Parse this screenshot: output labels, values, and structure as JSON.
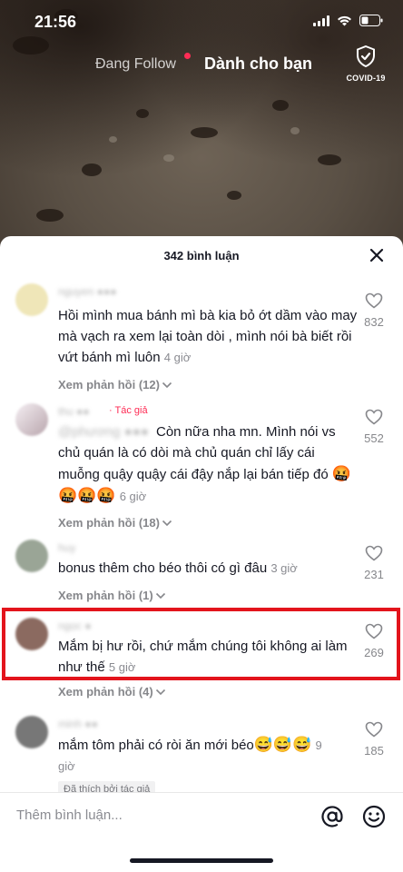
{
  "status_bar": {
    "time": "21:56"
  },
  "top_tabs": {
    "following": "Đang Follow",
    "for_you": "Dành cho bạn",
    "covid_label": "COVID-19"
  },
  "comments_sheet": {
    "title": "342 bình luận",
    "comments": [
      {
        "text": "Hồi mình mua bánh mì bà kia bỏ ớt dầm vào may mà vạch ra xem lại toàn dòi , mình nói bà biết rồi vứt bánh mì luôn",
        "time": "4 giờ",
        "likes": "832",
        "replies": "Xem phản hồi (12)"
      },
      {
        "author_tag": "· Tác giả",
        "text": "Còn nữa nha mn. Mình nói vs chủ quán là có dòi mà chủ quán chỉ lấy cái muỗng quậy quậy cái đậy nắp lại bán tiếp đó",
        "emojis": "🤬🤬🤬🤬",
        "time": "6 giờ",
        "likes": "552",
        "replies": "Xem phản hồi (18)"
      },
      {
        "text": "bonus thêm cho béo thôi có gì đâu",
        "time": "3 giờ",
        "likes": "231",
        "replies": "Xem phản hồi (1)"
      },
      {
        "text": "Mắm bị hư rồi, chứ mắm chúng tôi không ai làm như thế",
        "time": "5 giờ",
        "likes": "269",
        "replies": "Xem phản hồi (4)"
      },
      {
        "text": "mắm tôm phải có ròi ăn mới béo",
        "emojis": "😅😅😅",
        "time": "9 giờ",
        "likes": "185",
        "liked_by_creator": "Đã thích bởi tác giả"
      }
    ]
  },
  "input_bar": {
    "placeholder": "Thêm bình luận..."
  },
  "colors": {
    "accent": "#fe2c55",
    "highlight": "#e3141c",
    "text": "#161823",
    "muted": "#86878b"
  },
  "icons": [
    "wifi-icon",
    "battery-icon",
    "shield-icon",
    "close-icon",
    "heart-icon",
    "chevron-down-icon",
    "at-icon",
    "smiley-icon"
  ]
}
